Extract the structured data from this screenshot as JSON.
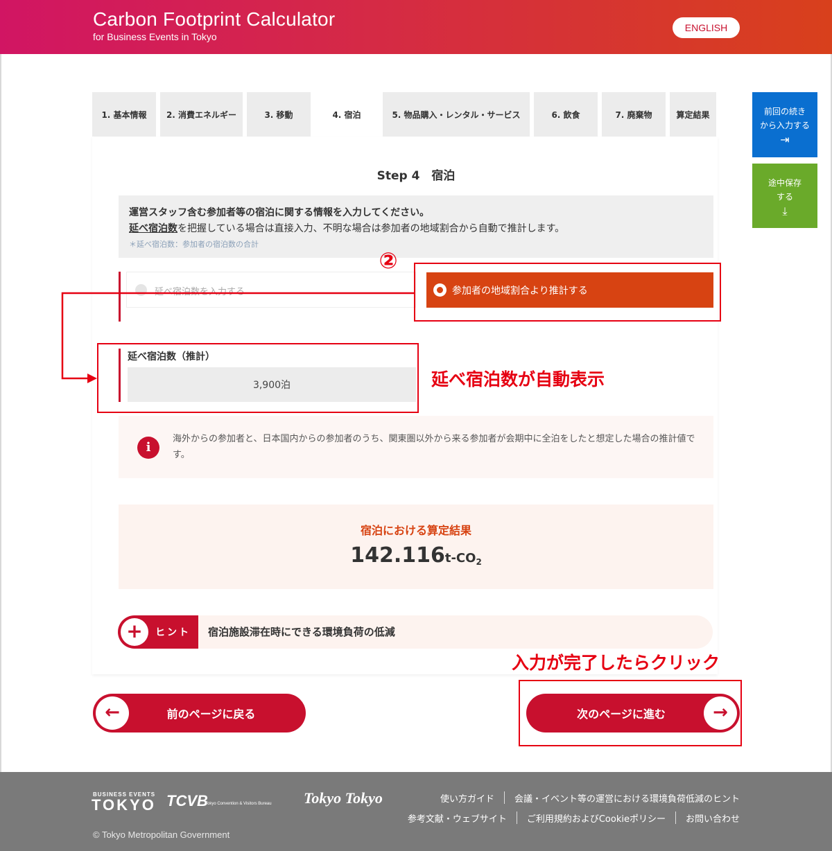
{
  "header": {
    "title": "Carbon Footprint Calculator",
    "subtitle": "for Business Events in Tokyo",
    "lang_button": "ENGLISH"
  },
  "tabs": [
    {
      "label": "1. 基本情報",
      "active": false
    },
    {
      "label": "2. 消費エネルギー",
      "active": false
    },
    {
      "label": "3. 移動",
      "active": false
    },
    {
      "label": "4. 宿泊",
      "active": true
    },
    {
      "label": "5. 物品購入・レンタル・サービス",
      "active": false
    },
    {
      "label": "6. 飲食",
      "active": false
    },
    {
      "label": "7. 廃棄物",
      "active": false
    },
    {
      "label": "算定結果",
      "active": false
    }
  ],
  "step": {
    "title": "Step 4　宿泊"
  },
  "info": {
    "line1": "運営スタッフ含む参加者等の宿泊に関する情報を入力してください。",
    "line2_link": "延べ宿泊数",
    "line2_rest": "を把握している場合は直接入力、不明な場合は参加者の地域割合から自動で推計します。",
    "note": "＊延べ宿泊数：参加者の宿泊数の合計"
  },
  "choices": {
    "manual": "延べ宿泊数を入力する",
    "estimate": "参加者の地域割合より推計する",
    "selected": "estimate"
  },
  "annotations": {
    "circle_number": "②",
    "auto_display": "延べ宿泊数が自動表示",
    "click_note": "入力が完了したらクリック"
  },
  "nights": {
    "label": "延べ宿泊数（推計）",
    "value": "3,900泊"
  },
  "notice": {
    "icon": "info-icon",
    "text": "海外からの参加者と、日本国内からの参加者のうち、関東圏以外から来る参加者が会期中に全泊をしたと想定した場合の推計値です。"
  },
  "result": {
    "title": "宿泊における算定結果",
    "value": "142.116",
    "unit_prefix": "t-CO",
    "unit_sub": "2"
  },
  "hint": {
    "label": "ヒント",
    "text": "宿泊施設滞在時にできる環境負荷の低減"
  },
  "nav": {
    "prev": "前のページに戻る",
    "next": "次のページに進む"
  },
  "side": {
    "resume_line1": "前回の続き",
    "resume_line2": "から入力する",
    "save_line1": "途中保存",
    "save_line2": "する"
  },
  "footer": {
    "logo_be_small": "BUSINESS EVENTS",
    "logo_be_big": "TOKYO",
    "logo_tcvb": "TCVB",
    "logo_tcvb_sub": "Tokyo Convention & Visitors Bureau",
    "logo_tt": "Tokyo Tokyo",
    "copyright": "© Tokyo Metropolitan Government",
    "links_row1": [
      "使い方ガイド",
      "会議・イベント等の運営における環境負荷低減のヒント"
    ],
    "links_row2": [
      "参考文献・ウェブサイト",
      "ご利用規約およびCookieポリシー",
      "お問い合わせ"
    ]
  },
  "colors": {
    "brand_red": "#c8102e",
    "accent_orange": "#d74312",
    "annotation_red": "#e60012",
    "resume_blue": "#0a6fd0",
    "save_green": "#6aaa2a"
  }
}
